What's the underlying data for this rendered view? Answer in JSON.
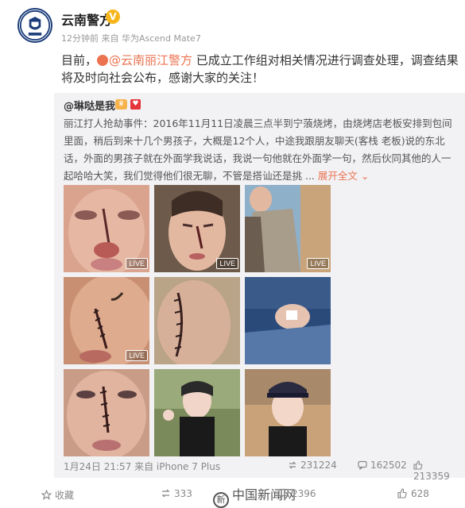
{
  "post": {
    "author": "云南警方",
    "verified_mark": "V",
    "meta": "12分钟前 来自 华为Ascend Mate7",
    "text_before": "目前，",
    "mention": "@云南丽江警方",
    "text_after": " 已成立工作组对相关情况进行调查处理，调查结果将及时向社会公布，感谢大家的关注！"
  },
  "repost": {
    "user": "@琳哒是我",
    "text": "丽江打人抢劫事件：2016年11月11日凌晨三点半到宁蒗烧烤，由烧烤店老板安排到包间里面，稍后到来十几个男孩子，大概是12个人，中途我跟朋友聊天(客栈 老板)说的东北话，外面的男孩子就在外面学我说话，我说一句他就在外面学一句，然后伙同其他的人一起哈哈大笑，我们觉得他们很无聊，不管是搭讪还是挑 ...",
    "more": "展开全文",
    "photos": [
      {
        "live": "LIVE"
      },
      {
        "live": "LIVE"
      },
      {
        "live": "LIVE"
      },
      {
        "live": "LIVE"
      },
      {
        "live": ""
      },
      {
        "live": ""
      },
      {
        "live": ""
      },
      {
        "live": ""
      },
      {
        "live": ""
      }
    ],
    "time": "1月24日 21:57 来自 iPhone 7 Plus",
    "reposts": "231224",
    "comments": "162502",
    "likes": "213359"
  },
  "actions": {
    "favorite": "收藏",
    "repost": "333",
    "watermark": "中国新闻网",
    "comment": "2396",
    "like": "628"
  },
  "colors": {
    "link": "#eb7350",
    "badge": "#f6b51a"
  }
}
